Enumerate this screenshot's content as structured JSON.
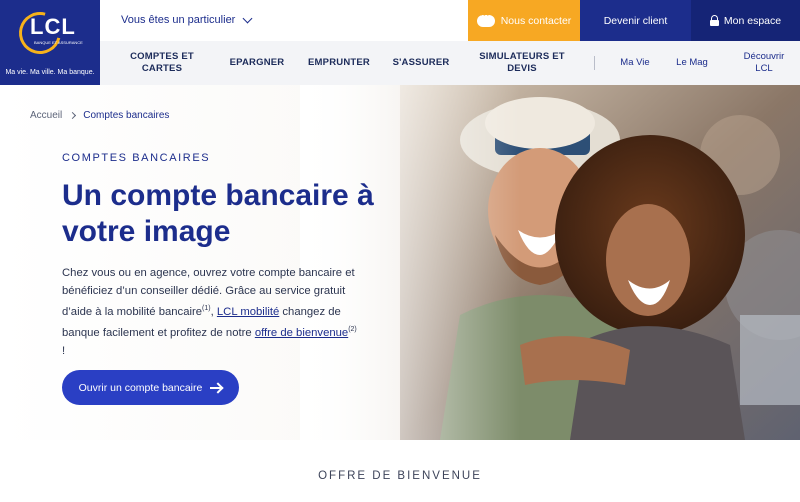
{
  "logo": {
    "brand": "LCL",
    "subtitle": "BANQUE ET ASSURANCE",
    "slogan": "Ma vie. Ma ville. Ma banque."
  },
  "topbar": {
    "audience": "Vous êtes un particulier",
    "contact": "Nous contacter",
    "client": "Devenir client",
    "espace": "Mon espace"
  },
  "nav": {
    "items": [
      "COMPTES ET CARTES",
      "EPARGNER",
      "EMPRUNTER",
      "S'ASSURER",
      "SIMULATEURS ET DEVIS"
    ],
    "secondary": [
      "Ma Vie",
      "Le Mag",
      "Découvrir LCL"
    ]
  },
  "breadcrumb": {
    "home": "Accueil",
    "current": "Comptes bancaires"
  },
  "hero": {
    "eyebrow": "COMPTES BANCAIRES",
    "title": "Un compte bancaire à votre image",
    "text_1": "Chez vous ou en agence, ouvrez votre compte bancaire et bénéficiez d’un conseiller dédié. Grâce au service gratuit d’aide à la mobilité bancaire",
    "sup_1": "(1)",
    "text_2": ", ",
    "link_1": "LCL mobilité",
    "text_3": " changez de banque facilement et profitez de notre ",
    "link_2": "offre de bienvenue",
    "sup_2": "(2)",
    "text_4": " !",
    "cta": "Ouvrir un compte bancaire"
  },
  "section": {
    "title": "OFFRE DE BIENVENUE"
  },
  "colors": {
    "primary": "#1c2d8c",
    "accent": "#f7a823",
    "cta": "#2a3fc4"
  }
}
